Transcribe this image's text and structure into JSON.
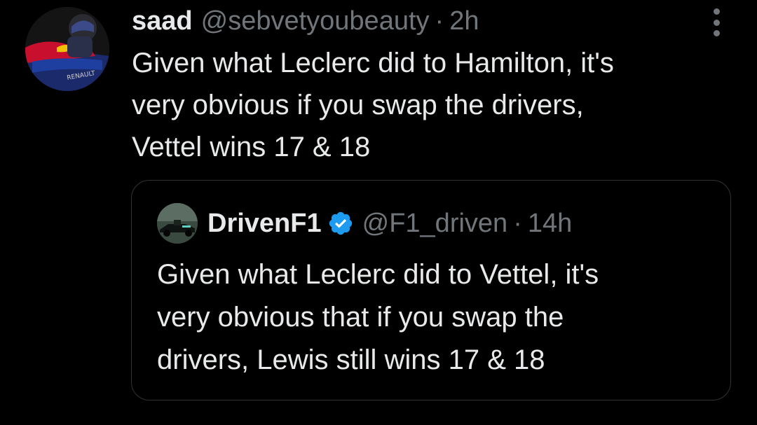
{
  "tweet": {
    "author": {
      "display_name": "saad",
      "handle": "@sebvetyoubeauty",
      "time": "2h",
      "separator": "·",
      "avatar_icon": "race-driver-avatar-icon"
    },
    "text": "Given what Leclerc did to Hamilton, it's\nvery obvious if you swap the drivers,\nVettel wins 17 & 18",
    "more_icon": "more-options-icon"
  },
  "quoted_tweet": {
    "author": {
      "display_name": "DrivenF1",
      "verified": true,
      "verified_icon": "verified-badge-icon",
      "handle": "@F1_driven",
      "time": "14h",
      "separator": "·",
      "avatar_icon": "race-car-avatar-icon"
    },
    "text": "Given what Leclerc did to Vettel, it's\nvery obvious that if you swap the\ndrivers, Lewis still wins 17 & 18"
  },
  "colors": {
    "background": "#000000",
    "text_primary": "#e7e9ea",
    "text_secondary": "#71767b",
    "border": "#2f3336",
    "verified_blue": "#1d9bf0"
  }
}
